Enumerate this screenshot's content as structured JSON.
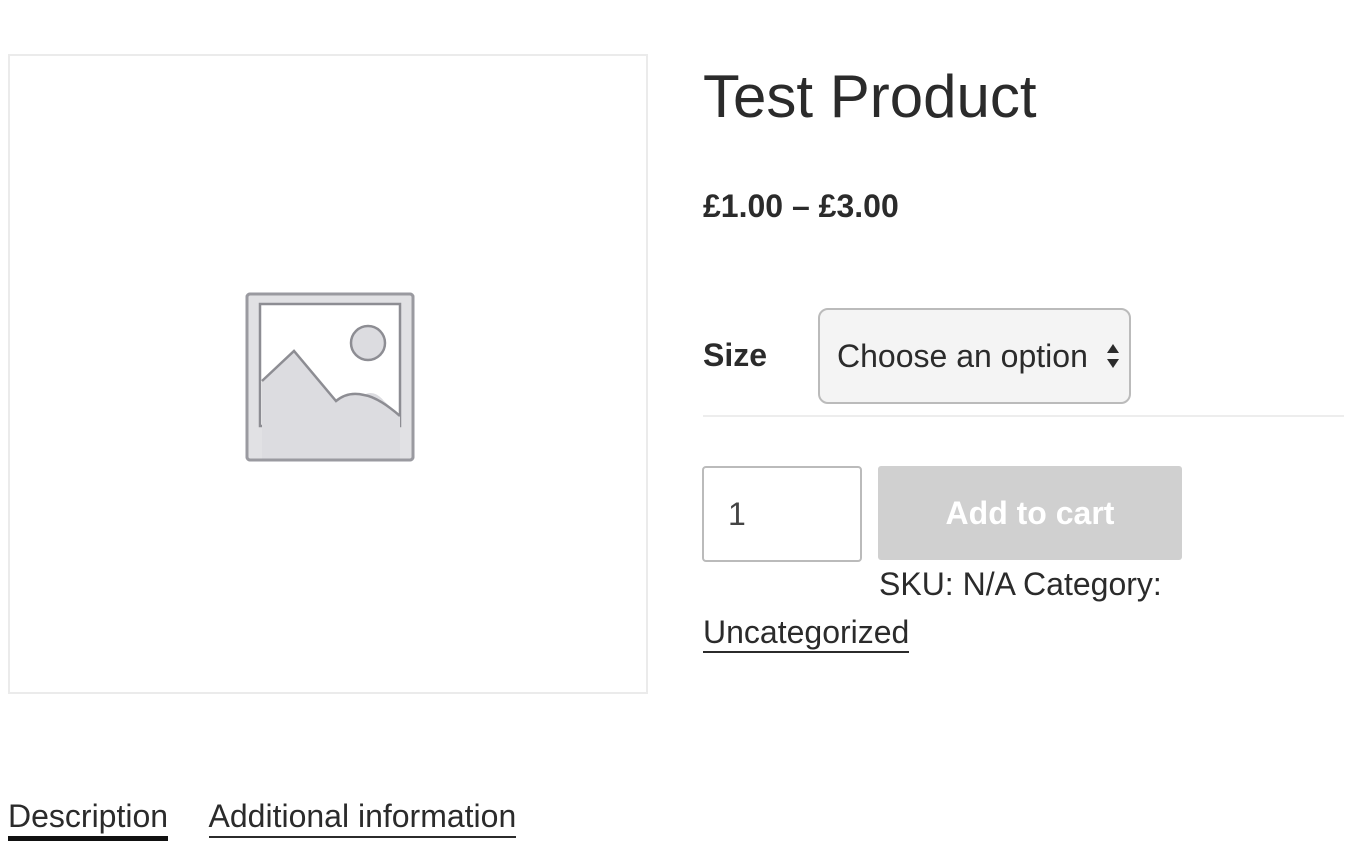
{
  "product": {
    "title": "Test Product",
    "price_range": "£1.00 – £3.00",
    "image_icon": "placeholder-image-icon"
  },
  "variations": {
    "size_label": "Size",
    "size_select": {
      "selected": "Choose an option"
    }
  },
  "cart": {
    "quantity": "1",
    "add_to_cart_label": "Add to cart"
  },
  "meta": {
    "sku_category_text": "SKU: N/A Category:",
    "category_link": "Uncategorized"
  },
  "tabs": [
    {
      "label": "Description"
    },
    {
      "label": "Additional information"
    }
  ],
  "colors": {
    "disabled_button": "#d0d0d0",
    "text": "#2b2b2b",
    "select_bg": "#f4f4f4"
  }
}
